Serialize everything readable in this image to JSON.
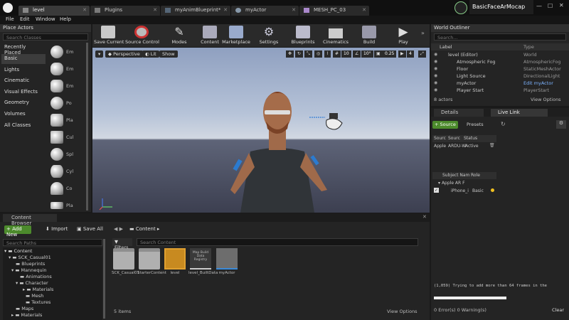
{
  "tabs": [
    {
      "label": "level"
    },
    {
      "label": "Plugins"
    },
    {
      "label": "myAnimBlueprint*"
    },
    {
      "label": "myActor"
    },
    {
      "label": "MESH_PC_03"
    }
  ],
  "brand": "BasicFaceArMocap",
  "menu": [
    "File",
    "Edit",
    "Window",
    "Help"
  ],
  "place_actors": {
    "title": "Place Actors",
    "search_placeholder": "Search Classes",
    "categories": [
      "Recently Placed",
      "Basic",
      "Lights",
      "Cinematic",
      "Visual Effects",
      "Geometry",
      "Volumes",
      "All Classes"
    ],
    "selected": "Basic",
    "items": [
      "Em",
      "Em",
      "Em",
      "Po",
      "Pla",
      "Cul",
      "Spl",
      "Cyl",
      "Co",
      "Pla"
    ]
  },
  "toolbar": {
    "buttons": [
      "Save Current",
      "Source Control",
      "Modes",
      "Content",
      "Marketplace",
      "Settings",
      "Blueprints",
      "Cinematics",
      "Build",
      "Play"
    ]
  },
  "viewport": {
    "perspective": "Perspective",
    "lit": "Lit",
    "show": "Show",
    "grid_value": "10",
    "angle_value": "10°",
    "scale_value": "0.25",
    "camera_speed": "4"
  },
  "outliner": {
    "title": "World Outliner",
    "search_placeholder": "Search...",
    "col_label": "Label",
    "col_type": "Type",
    "rows": [
      {
        "name": "level (Editor)",
        "type": "World"
      },
      {
        "name": "Atmospheric Fog",
        "type": "AtmosphericFog"
      },
      {
        "name": "Floor",
        "type": "StaticMeshActor"
      },
      {
        "name": "Light Source",
        "type": "DirectionalLight"
      },
      {
        "name": "myActor",
        "type": "Edit myActor"
      },
      {
        "name": "Player Start",
        "type": "PlayerStart"
      }
    ],
    "count": "8 actors",
    "view_options": "View Options"
  },
  "details": {
    "tab_details": "Details",
    "tab_livelink": "Live Link",
    "source_button": "+ Source",
    "presets": "Presets",
    "sources_cols": [
      "Sourc",
      "Sourc",
      "Status"
    ],
    "source_row": {
      "a": "Apple",
      "b": "ARDU-W",
      "status": "Active"
    },
    "subjects_cols": [
      "Subject Nam",
      "Role"
    ],
    "subject_group": "Apple AR F",
    "subject_row": {
      "name": "iPhone_i",
      "role": "Basic"
    }
  },
  "content_browser": {
    "title": "Content Browser",
    "add_new": "Add New",
    "import": "Import",
    "save_all": "Save All",
    "path": "Content",
    "filters": "Filters",
    "search_paths": "Search Paths",
    "search_content": "Search Content",
    "tree": [
      "Content",
      "SCK_Casual01",
      "Blueprints",
      "Mannequin",
      "Animations",
      "Character",
      "Materials",
      "Mesh",
      "Textures",
      "Maps",
      "Materials",
      "Models"
    ],
    "assets": [
      {
        "label": "SCK_Casual01"
      },
      {
        "label": "StarterContent"
      },
      {
        "label": "level"
      },
      {
        "label": "level_BuiltData",
        "thumb_text": "Map Build Data Registry"
      },
      {
        "label": "myActor"
      }
    ],
    "count": "5 items",
    "view_options": "View Options"
  },
  "log": {
    "message": "(1,059) Trying to add more than 64 frames in the",
    "status": "0 Error(s)  0 Warning(s)",
    "clear": "Clear"
  }
}
